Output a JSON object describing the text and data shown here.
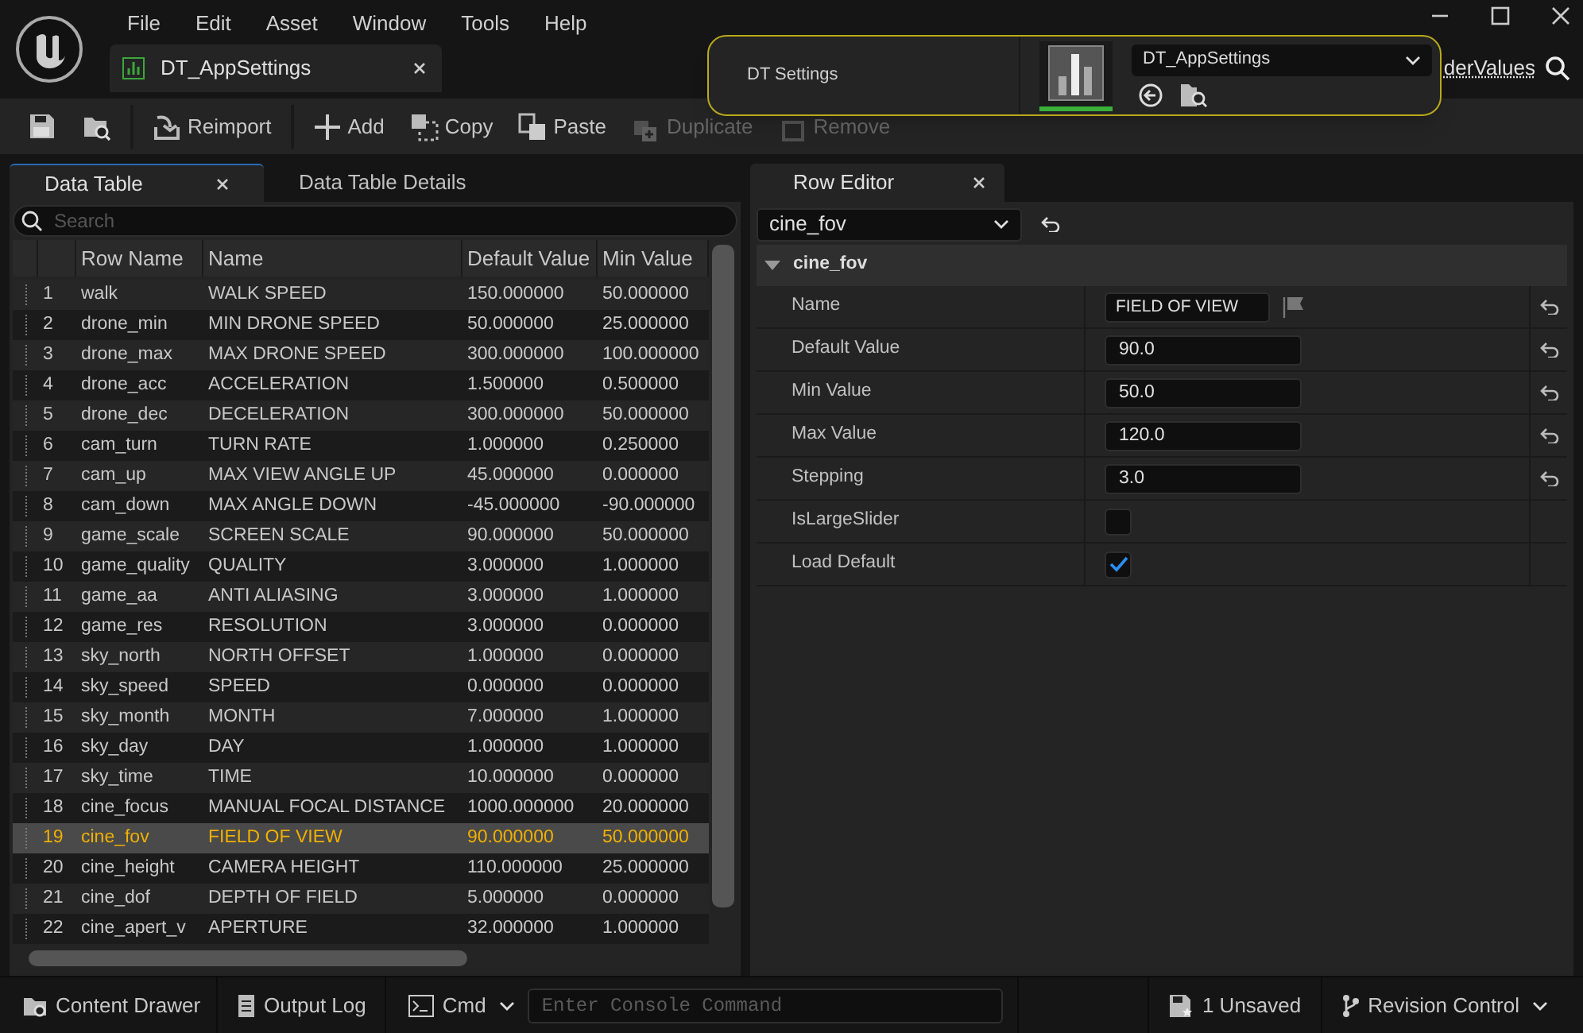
{
  "menu": [
    "File",
    "Edit",
    "Asset",
    "Window",
    "Tools",
    "Help"
  ],
  "document_tab": {
    "title": "DT_AppSettings"
  },
  "toolbar": [
    {
      "disabled": false
    },
    {
      "disabled": false
    },
    {
      "label": "Reimport",
      "disabled": false
    },
    {
      "label": "Add",
      "disabled": false
    },
    {
      "label": "Copy",
      "disabled": false
    },
    {
      "label": "Paste",
      "disabled": false
    },
    {
      "label": "Duplicate",
      "disabled": true
    },
    {
      "label": "Remove",
      "disabled": true
    }
  ],
  "link_fragment": "derValues",
  "popup": {
    "title": "DT Settings",
    "asset": "DT_AppSettings"
  },
  "left_tabs": [
    {
      "label": "Data Table",
      "selected": true,
      "closable": true
    },
    {
      "label": "Data Table Details",
      "selected": false,
      "closable": false
    }
  ],
  "search": {
    "placeholder": "Search"
  },
  "table": {
    "columns": [
      "Row Name",
      "Name",
      "Default Value",
      "Min Value"
    ],
    "rows": [
      {
        "index": "1",
        "row_name": "walk",
        "name": "WALK SPEED",
        "default": "150.000000",
        "min": "50.000000",
        "selected": false
      },
      {
        "index": "2",
        "row_name": "drone_min",
        "name": "MIN DRONE SPEED",
        "default": "50.000000",
        "min": "25.000000",
        "selected": false
      },
      {
        "index": "3",
        "row_name": "drone_max",
        "name": "MAX DRONE SPEED",
        "default": "300.000000",
        "min": "100.000000",
        "selected": false
      },
      {
        "index": "4",
        "row_name": "drone_acc",
        "name": "ACCELERATION",
        "default": "1.500000",
        "min": "0.500000",
        "selected": false
      },
      {
        "index": "5",
        "row_name": "drone_dec",
        "name": "DECELERATION",
        "default": "300.000000",
        "min": "50.000000",
        "selected": false
      },
      {
        "index": "6",
        "row_name": "cam_turn",
        "name": "TURN RATE",
        "default": "1.000000",
        "min": "0.250000",
        "selected": false
      },
      {
        "index": "7",
        "row_name": "cam_up",
        "name": "MAX VIEW ANGLE UP",
        "default": "45.000000",
        "min": "0.000000",
        "selected": false
      },
      {
        "index": "8",
        "row_name": "cam_down",
        "name": "MAX ANGLE DOWN",
        "default": "-45.000000",
        "min": "-90.000000",
        "selected": false
      },
      {
        "index": "9",
        "row_name": "game_scale",
        "name": "SCREEN SCALE",
        "default": "90.000000",
        "min": "50.000000",
        "selected": false
      },
      {
        "index": "10",
        "row_name": "game_quality",
        "name": "QUALITY",
        "default": "3.000000",
        "min": "1.000000",
        "selected": false
      },
      {
        "index": "11",
        "row_name": "game_aa",
        "name": "ANTI ALIASING",
        "default": "3.000000",
        "min": "1.000000",
        "selected": false
      },
      {
        "index": "12",
        "row_name": "game_res",
        "name": "RESOLUTION",
        "default": "3.000000",
        "min": "0.000000",
        "selected": false
      },
      {
        "index": "13",
        "row_name": "sky_north",
        "name": "NORTH OFFSET",
        "default": "1.000000",
        "min": "0.000000",
        "selected": false
      },
      {
        "index": "14",
        "row_name": "sky_speed",
        "name": "SPEED",
        "default": "0.000000",
        "min": "0.000000",
        "selected": false
      },
      {
        "index": "15",
        "row_name": "sky_month",
        "name": "MONTH",
        "default": "7.000000",
        "min": "1.000000",
        "selected": false
      },
      {
        "index": "16",
        "row_name": "sky_day",
        "name": "DAY",
        "default": "1.000000",
        "min": "1.000000",
        "selected": false
      },
      {
        "index": "17",
        "row_name": "sky_time",
        "name": "TIME",
        "default": "10.000000",
        "min": "0.000000",
        "selected": false
      },
      {
        "index": "18",
        "row_name": "cine_focus",
        "name": "MANUAL FOCAL DISTANCE",
        "default": "1000.000000",
        "min": "20.000000",
        "selected": false
      },
      {
        "index": "19",
        "row_name": "cine_fov",
        "name": "FIELD OF VIEW",
        "default": "90.000000",
        "min": "50.000000",
        "selected": true
      },
      {
        "index": "20",
        "row_name": "cine_height",
        "name": "CAMERA HEIGHT",
        "default": "110.000000",
        "min": "25.000000",
        "selected": false
      },
      {
        "index": "21",
        "row_name": "cine_dof",
        "name": "DEPTH OF FIELD",
        "default": "5.000000",
        "min": "0.000000",
        "selected": false
      },
      {
        "index": "22",
        "row_name": "cine_apert_v",
        "name": "APERTURE",
        "default": "32.000000",
        "min": "1.000000",
        "selected": false
      }
    ]
  },
  "right_tab": {
    "label": "Row Editor",
    "selected": true
  },
  "row_picker": {
    "value": "cine_fov"
  },
  "section": {
    "title": "cine_fov",
    "expanded": true
  },
  "properties": [
    {
      "kind": "name",
      "label": "Name",
      "value": "FIELD OF VIEW",
      "resettable": true
    },
    {
      "kind": "number",
      "label": "Default Value",
      "value": "90.0",
      "resettable": true
    },
    {
      "kind": "number",
      "label": "Min Value",
      "value": "50.0",
      "resettable": true
    },
    {
      "kind": "number",
      "label": "Max Value",
      "value": "120.0",
      "resettable": true
    },
    {
      "kind": "number",
      "label": "Stepping",
      "value": "3.0",
      "resettable": true
    },
    {
      "kind": "checkbox",
      "label": "IsLargeSlider",
      "checked": false,
      "resettable": false
    },
    {
      "kind": "checkbox",
      "label": "Load Default",
      "checked": true,
      "resettable": false
    }
  ],
  "status_bar": {
    "content_drawer": "Content Drawer",
    "output_log": "Output Log",
    "cmd": "Cmd",
    "console": {
      "placeholder": "Enter Console Command"
    },
    "unsaved": "1 Unsaved",
    "revision_control": "Revision Control"
  }
}
